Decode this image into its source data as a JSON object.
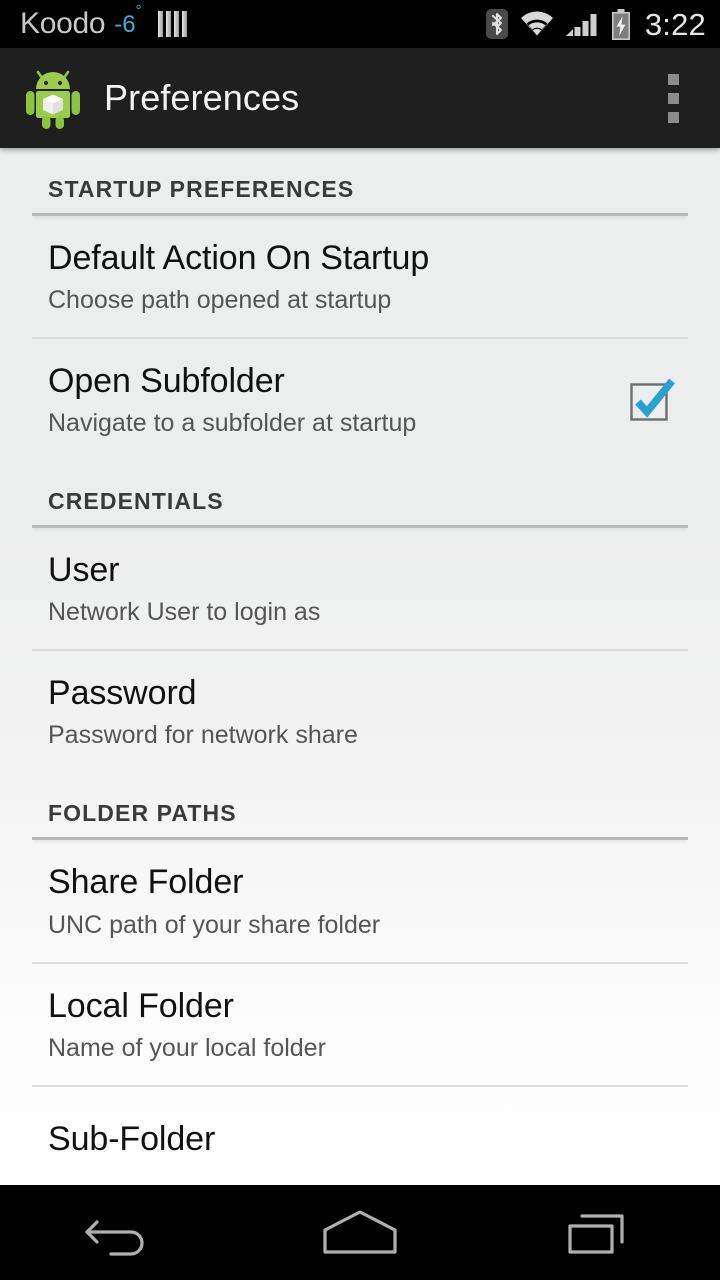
{
  "status_bar": {
    "carrier": "Koodo",
    "temperature": "-6",
    "degree": "°",
    "time": "3:22",
    "icons": [
      "weather-bars-icon",
      "bluetooth-icon",
      "wifi-icon",
      "cellular-signal-icon",
      "battery-charging-icon"
    ],
    "colors": {
      "temperature": "#3badd6",
      "carrier": "#c8c8c8",
      "background": "#000000"
    }
  },
  "action_bar": {
    "title": "Preferences",
    "app_icon": "android-robot-icon",
    "overflow_label": "overflow-menu-icon",
    "colors": {
      "background": "#1f1f1f",
      "title": "#f2f2f2"
    }
  },
  "sections": [
    {
      "header": "STARTUP PREFERENCES",
      "items": [
        {
          "title": "Default Action On Startup",
          "summary": "Choose path opened at startup",
          "widget": "none"
        },
        {
          "title": "Open Subfolder",
          "summary": "Navigate to a subfolder at startup",
          "widget": "checkbox",
          "checked": true
        }
      ]
    },
    {
      "header": "CREDENTIALS",
      "items": [
        {
          "title": "User",
          "summary": "Network User to login as",
          "widget": "none"
        },
        {
          "title": "Password",
          "summary": "Password for network share",
          "widget": "none"
        }
      ]
    },
    {
      "header": "FOLDER PATHS",
      "items": [
        {
          "title": "Share Folder",
          "summary": "UNC path of your share folder",
          "widget": "none"
        },
        {
          "title": "Local Folder",
          "summary": "Name of your local folder",
          "widget": "none"
        },
        {
          "title": "Sub-Folder",
          "summary": "",
          "widget": "none"
        }
      ]
    }
  ],
  "nav_bar": {
    "buttons": [
      {
        "name": "back-icon",
        "label": "Back"
      },
      {
        "name": "home-icon",
        "label": "Home"
      },
      {
        "name": "recents-icon",
        "label": "Recent apps"
      }
    ],
    "colors": {
      "background": "#000000",
      "icon": "#b0b0b0"
    }
  },
  "theme": {
    "checkbox_accent": "#28a2ce",
    "checkbox_border": "#6e6e6e",
    "divider": "#dcdcdc",
    "section_rule": "#b9b9b9",
    "title_text": "#111111",
    "summary_text": "#555555",
    "header_text": "#3a3a3a"
  }
}
